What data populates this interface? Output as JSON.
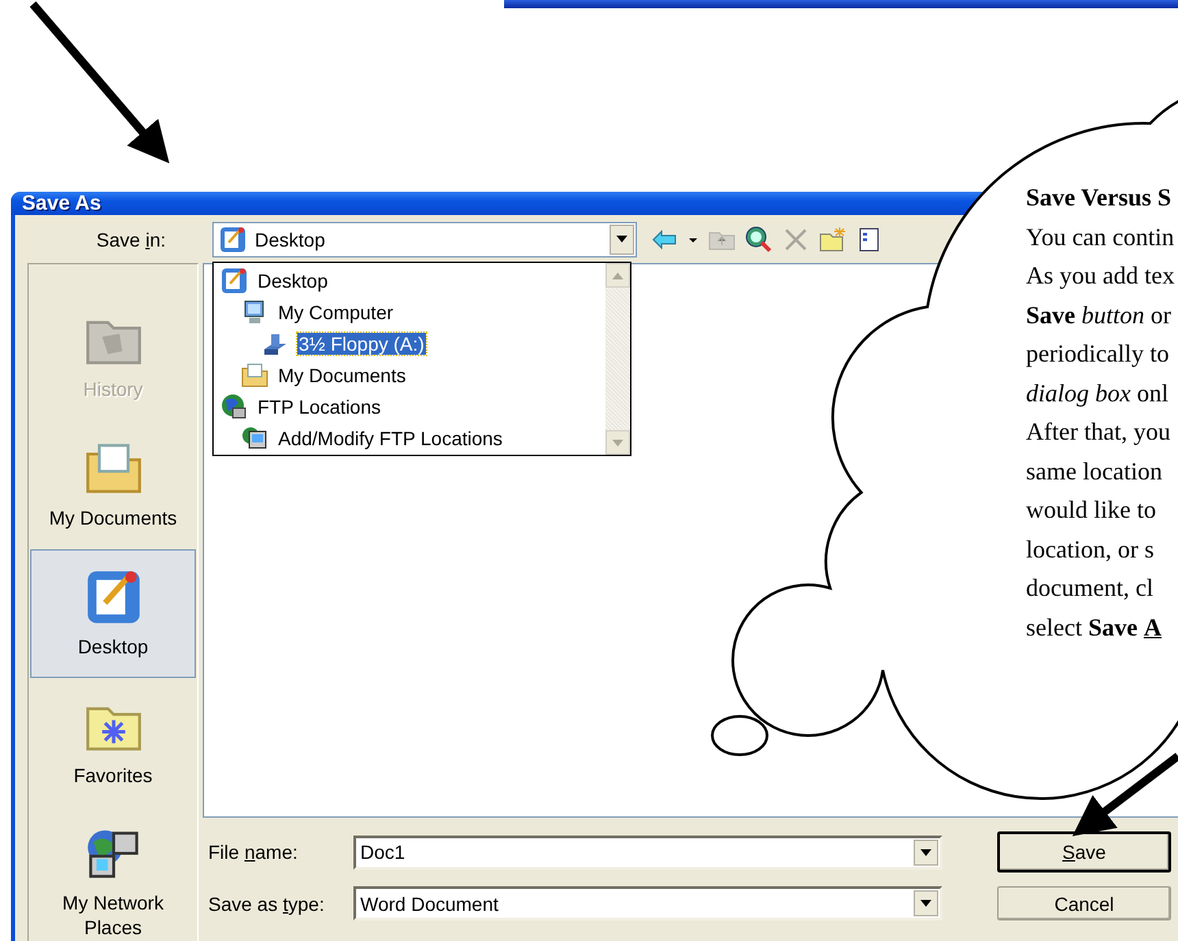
{
  "dialog": {
    "title": "Save As",
    "save_in": {
      "label": {
        "before": "Save ",
        "accel": "i",
        "after": "n:"
      },
      "value": "Desktop",
      "expanded": true
    },
    "toolbar": [
      {
        "kind": "back",
        "disabled": false
      },
      {
        "kind": "caret",
        "disabled": false
      },
      {
        "kind": "up-folder",
        "disabled": true
      },
      {
        "kind": "search-web",
        "disabled": false
      },
      {
        "kind": "delete",
        "disabled": true
      },
      {
        "kind": "new-folder",
        "disabled": false
      },
      {
        "kind": "views",
        "disabled": false
      }
    ],
    "locations": [
      {
        "label": "Desktop",
        "kind": "desktop",
        "selected": false,
        "children": [
          {
            "label": "My Computer",
            "kind": "computer",
            "selected": false,
            "children": [
              {
                "label": "3½ Floppy (A:)",
                "kind": "floppy",
                "selected": true
              }
            ]
          },
          {
            "label": "My Documents",
            "kind": "documents",
            "selected": false
          }
        ]
      },
      {
        "label": "FTP Locations",
        "kind": "ftp",
        "selected": false,
        "children": [
          {
            "label": "Add/Modify FTP Locations",
            "kind": "ftp-add",
            "selected": false
          }
        ]
      }
    ],
    "places": [
      {
        "label": "History",
        "kind": "history",
        "selected": false,
        "disabled": true
      },
      {
        "label": "My Documents",
        "kind": "documents",
        "selected": false,
        "disabled": false
      },
      {
        "label": "Desktop",
        "kind": "desktop",
        "selected": true,
        "disabled": false
      },
      {
        "label": "Favorites",
        "kind": "favorites",
        "selected": false,
        "disabled": false
      },
      {
        "label": "My Network Places",
        "kind": "network",
        "selected": false,
        "disabled": false
      }
    ],
    "file_name": {
      "label": {
        "before": "File ",
        "accel": "n",
        "after": "ame:"
      },
      "value": "Doc1"
    },
    "save_as_type": {
      "label": {
        "before": "Save as ",
        "accel": "t",
        "after": "ype:"
      },
      "value": "Word Document"
    },
    "buttons": [
      {
        "label": {
          "accel": "S",
          "after": "ave"
        },
        "default": true
      },
      {
        "label": {
          "before": "Cancel"
        },
        "default": false
      }
    ]
  },
  "callout": {
    "lines": [
      {
        "text": "Save Versus S",
        "bold": true
      },
      {
        "text": "You can contin",
        "bold": false
      },
      {
        "text": "As you add tex",
        "bold": false
      },
      {
        "text": "**Save** *button* or",
        "bold": false
      },
      {
        "text": "periodically to",
        "bold": false
      },
      {
        "text": "*dialog box* onl",
        "bold": false
      },
      {
        "text": "After that, you",
        "bold": false
      },
      {
        "text": "same location",
        "bold": false
      },
      {
        "text": "would like to",
        "bold": false
      },
      {
        "text": "location, or s",
        "bold": false
      },
      {
        "text": "document, cl",
        "bold": false
      },
      {
        "text": "select **Save** ",
        "underlined": "A",
        "bold": false
      }
    ]
  }
}
